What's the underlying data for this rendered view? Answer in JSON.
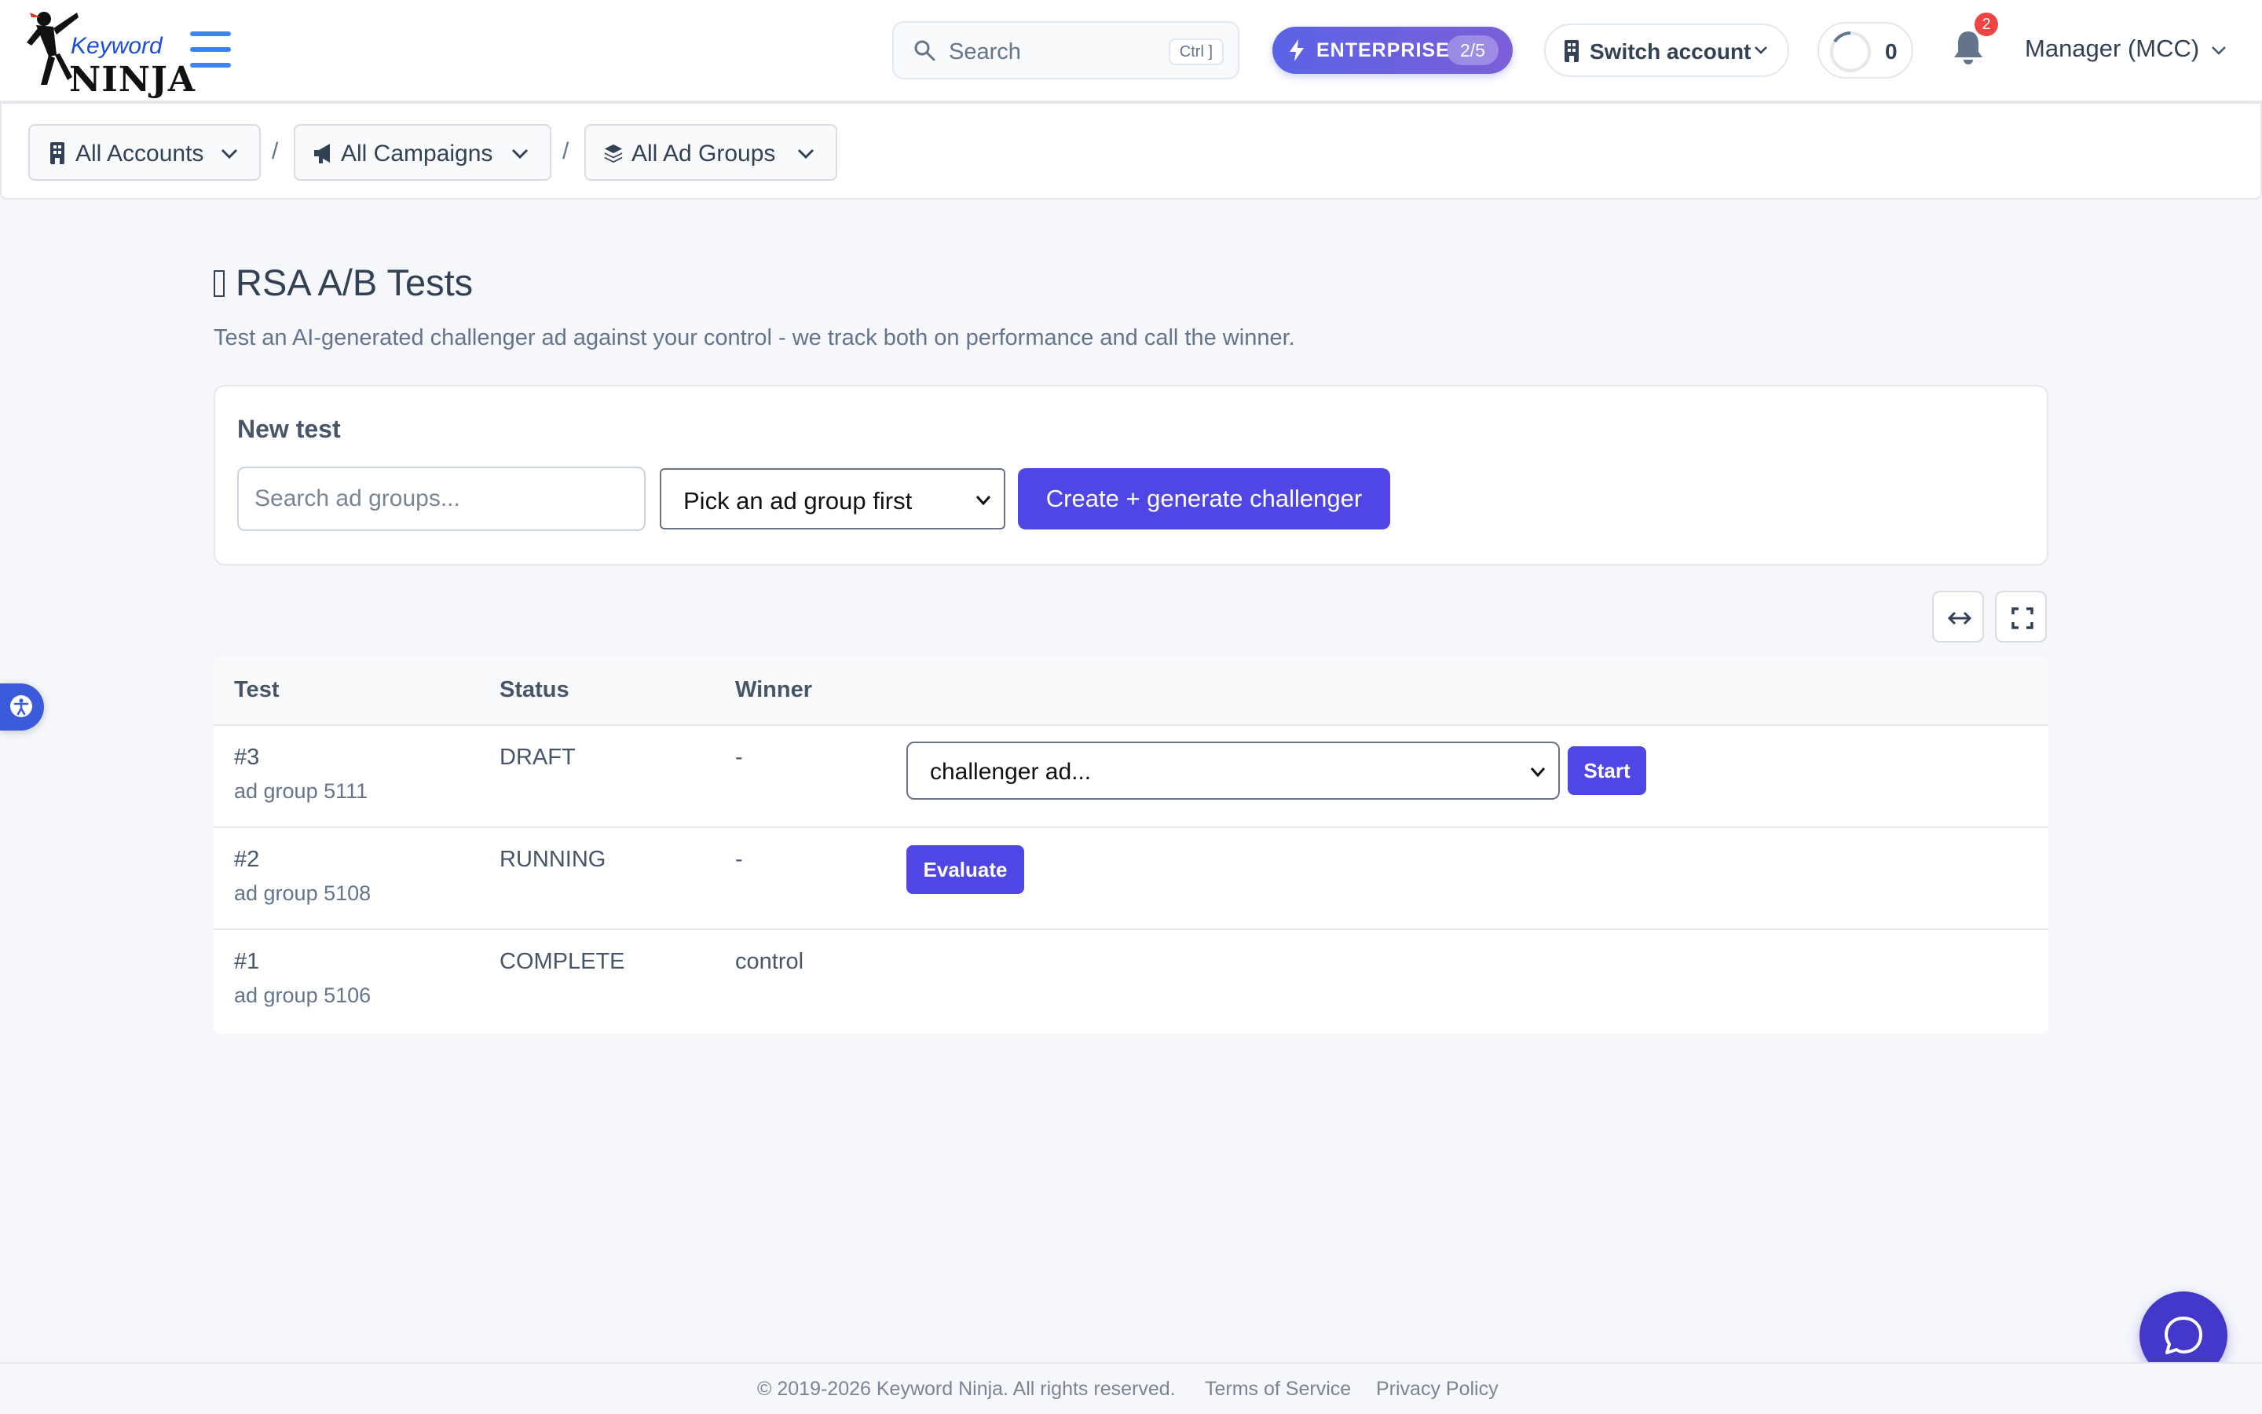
{
  "brand": {
    "logo_word1": "Keyword",
    "logo_word2": "NINJA"
  },
  "header": {
    "search_placeholder": "Search",
    "search_shortcut": "Ctrl ]",
    "plan_label": "ENTERPRISE",
    "plan_usage": "2/5",
    "switch_account_label": "Switch account",
    "credits_count": "0",
    "notification_count": "2",
    "account_label": "Manager (MCC)"
  },
  "breadcrumb": {
    "accounts": "All Accounts",
    "campaigns": "All Campaigns",
    "ad_groups": "All Ad Groups",
    "separator": "/"
  },
  "page": {
    "title": "RSA A/B Tests",
    "subtitle": "Test an AI-generated challenger ad against your control - we track both on performance and call the winner."
  },
  "new_test": {
    "heading": "New test",
    "search_placeholder": "Search ad groups...",
    "select_value": "Pick an ad group first",
    "create_button": "Create + generate challenger"
  },
  "table": {
    "columns": [
      "Test",
      "Status",
      "Winner"
    ],
    "rows": [
      {
        "id": "#3",
        "ad_group": "ad group 5111",
        "status": "DRAFT",
        "winner": "-",
        "select_value": "challenger ad...",
        "action": "Start"
      },
      {
        "id": "#2",
        "ad_group": "ad group 5108",
        "status": "RUNNING",
        "winner": "-",
        "action": "Evaluate"
      },
      {
        "id": "#1",
        "ad_group": "ad group 5106",
        "status": "COMPLETE",
        "winner": "control"
      }
    ]
  },
  "footer": {
    "copyright": "© 2019-2026 Keyword Ninja. All rights reserved.",
    "terms": "Terms of Service",
    "privacy": "Privacy Policy"
  },
  "colors": {
    "primary": "#4f46e5",
    "accent_blue": "#3b82f6",
    "badge_red": "#ef4444",
    "background": "#f5f7fb"
  },
  "icons": [
    "search-icon",
    "bolt-icon",
    "building-icon",
    "chevron-down-icon",
    "bell-icon",
    "megaphone-icon",
    "layers-icon",
    "expand-width-icon",
    "fullscreen-icon",
    "accessibility-icon",
    "chat-icon"
  ]
}
